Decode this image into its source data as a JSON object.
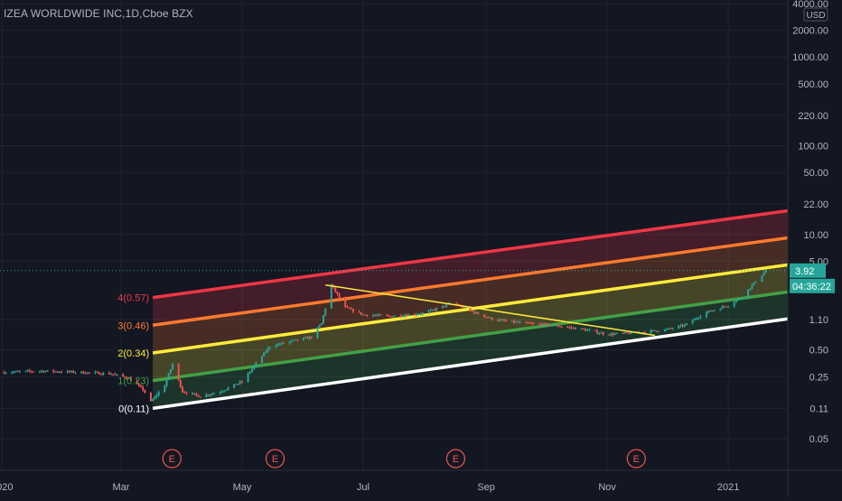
{
  "header": {
    "symbol": "IZEA WORLDWIDE INC",
    "interval": "1D",
    "exchange": "Cboe BZX",
    "sep1": ", ",
    "sep2": ", "
  },
  "price_axis": {
    "currency": "USD",
    "current_price": "3.92",
    "countdown": "04:36:22",
    "price_tag_color": "#26a69a"
  },
  "colors": {
    "background": "#131722",
    "bull": "#26a69a",
    "bear": "#ef5350",
    "text": "#b2b5be",
    "earnings": "#ef5350"
  },
  "earnings_markers": [
    {
      "date": "2020-03-23",
      "label": "E"
    },
    {
      "date": "2020-05-14",
      "label": "E"
    },
    {
      "date": "2020-08-13",
      "label": "E"
    },
    {
      "date": "2020-11-12",
      "label": "E"
    }
  ],
  "fib_channel": {
    "levels": [
      {
        "label": "4(0.57)",
        "color": "#f23645"
      },
      {
        "label": "3(0.46)",
        "color": "#ff7a2e"
      },
      {
        "label": "2(0.34)",
        "color": "#ffeb3b"
      },
      {
        "label": "1(0.23)",
        "color": "#43a047"
      },
      {
        "label": "0(0.11)",
        "color": "#ffffff"
      }
    ],
    "diagonal_color": "#ffeb3b"
  },
  "chart_data": {
    "type": "candlestick",
    "title": "IZEA WORLDWIDE INC, 1D, Cboe BZX",
    "y_scale": "log",
    "ylim": [
      0.03,
      4000
    ],
    "y_ticks": [
      "4000.00",
      "2000.00",
      "1000.00",
      "500.00",
      "220.00",
      "100.00",
      "50.00",
      "22.00",
      "10.00",
      "5.00",
      "1.10",
      "0.50",
      "0.25",
      "0.11",
      "0.05"
    ],
    "x_range": [
      "2019-12-31",
      "2021-01-31"
    ],
    "x_ticks": [
      {
        "label": "2020",
        "date": "2020-01-01"
      },
      {
        "label": "Mar",
        "date": "2020-03-01"
      },
      {
        "label": "May",
        "date": "2020-05-01"
      },
      {
        "label": "Jul",
        "date": "2020-07-01"
      },
      {
        "label": "Sep",
        "date": "2020-09-01"
      },
      {
        "label": "Nov",
        "date": "2020-11-01"
      },
      {
        "label": "2021",
        "date": "2021-01-01"
      }
    ],
    "price_points": [
      {
        "date": "2020-01-02",
        "close": 0.28
      },
      {
        "date": "2020-01-20",
        "close": 0.29
      },
      {
        "date": "2020-02-10",
        "close": 0.28
      },
      {
        "date": "2020-02-25",
        "close": 0.27
      },
      {
        "date": "2020-03-05",
        "close": 0.24
      },
      {
        "date": "2020-03-12",
        "close": 0.18
      },
      {
        "date": "2020-03-16",
        "close": 0.13
      },
      {
        "date": "2020-03-23",
        "close": 0.2
      },
      {
        "date": "2020-03-27",
        "close": 0.35
      },
      {
        "date": "2020-04-01",
        "close": 0.17
      },
      {
        "date": "2020-04-10",
        "close": 0.15
      },
      {
        "date": "2020-04-20",
        "close": 0.17
      },
      {
        "date": "2020-05-01",
        "close": 0.22
      },
      {
        "date": "2020-05-08",
        "close": 0.35
      },
      {
        "date": "2020-05-15",
        "close": 0.55
      },
      {
        "date": "2020-05-25",
        "close": 0.62
      },
      {
        "date": "2020-06-05",
        "close": 0.7
      },
      {
        "date": "2020-06-10",
        "close": 1.0
      },
      {
        "date": "2020-06-15",
        "close": 2.7
      },
      {
        "date": "2020-06-22",
        "close": 1.5
      },
      {
        "date": "2020-07-01",
        "close": 1.25
      },
      {
        "date": "2020-07-15",
        "close": 1.2
      },
      {
        "date": "2020-08-01",
        "close": 1.3
      },
      {
        "date": "2020-08-15",
        "close": 1.7
      },
      {
        "date": "2020-08-25",
        "close": 1.35
      },
      {
        "date": "2020-09-05",
        "close": 1.1
      },
      {
        "date": "2020-09-20",
        "close": 1.0
      },
      {
        "date": "2020-10-05",
        "close": 0.95
      },
      {
        "date": "2020-10-20",
        "close": 0.85
      },
      {
        "date": "2020-11-01",
        "close": 0.75
      },
      {
        "date": "2020-11-15",
        "close": 0.78
      },
      {
        "date": "2020-12-01",
        "close": 0.85
      },
      {
        "date": "2020-12-10",
        "close": 0.95
      },
      {
        "date": "2020-12-20",
        "close": 1.3
      },
      {
        "date": "2021-01-01",
        "close": 1.6
      },
      {
        "date": "2021-01-08",
        "close": 2.0
      },
      {
        "date": "2021-01-15",
        "close": 3.0
      },
      {
        "date": "2021-01-20",
        "close": 3.92
      }
    ],
    "fib_anchor": [
      {
        "date": "2020-03-17",
        "price": 0.11
      },
      {
        "date": "2021-01-31",
        "price": 1.12
      }
    ],
    "fib_channel_top": [
      {
        "date": "2020-03-17",
        "price": 1.95
      },
      {
        "date": "2021-01-31",
        "price": 18.5
      }
    ],
    "diagonal_line": [
      {
        "date": "2020-06-12",
        "price": 2.7
      },
      {
        "date": "2020-11-25",
        "price": 0.73
      }
    ]
  }
}
